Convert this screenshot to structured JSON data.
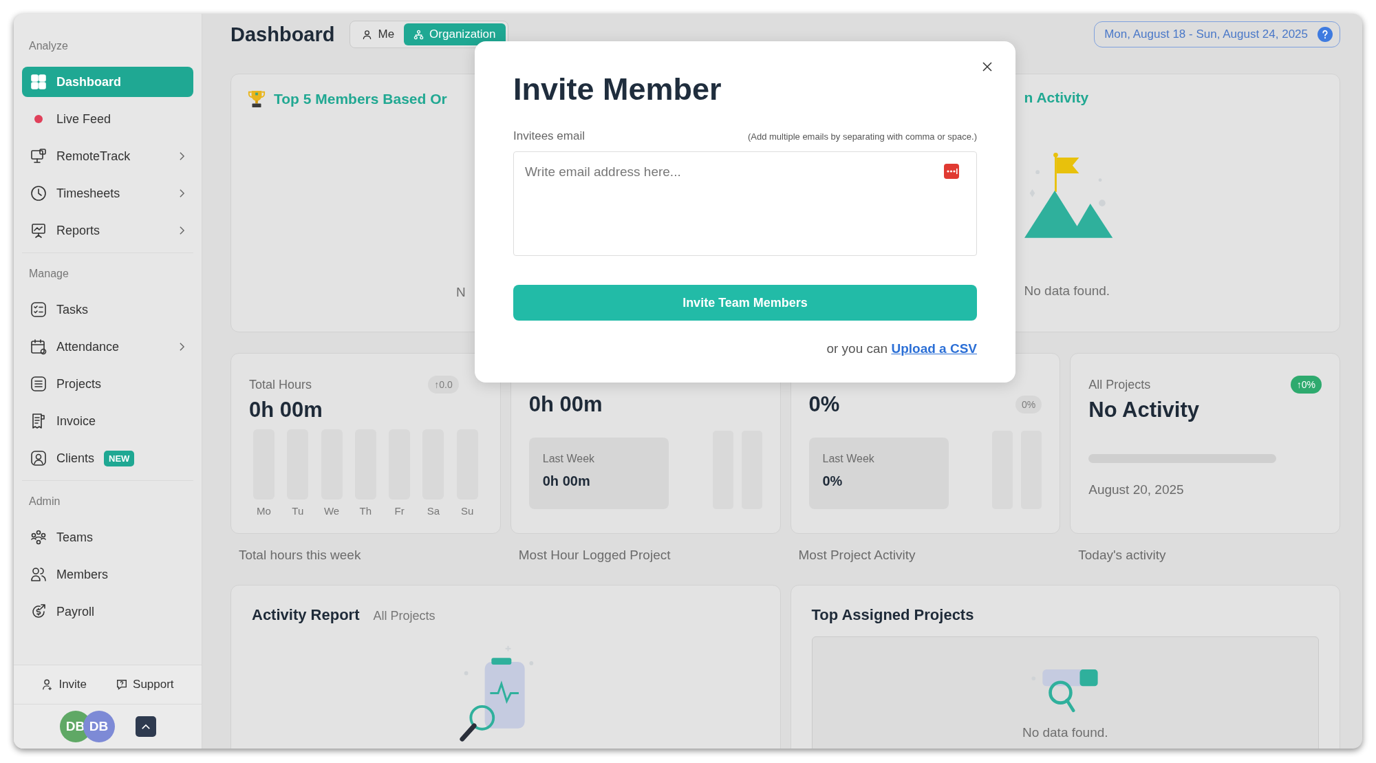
{
  "sidebar": {
    "sections": [
      {
        "title": "Analyze",
        "items": [
          {
            "label": "Dashboard",
            "selected": true,
            "submenu": false
          },
          {
            "label": "Live Feed",
            "selected": false,
            "submenu": false
          },
          {
            "label": "RemoteTrack",
            "selected": false,
            "submenu": true
          },
          {
            "label": "Timesheets",
            "selected": false,
            "submenu": true
          },
          {
            "label": "Reports",
            "selected": false,
            "submenu": true
          }
        ]
      },
      {
        "title": "Manage",
        "items": [
          {
            "label": "Tasks",
            "selected": false,
            "submenu": false
          },
          {
            "label": "Attendance",
            "selected": false,
            "submenu": true
          },
          {
            "label": "Projects",
            "selected": false,
            "submenu": false
          },
          {
            "label": "Invoice",
            "selected": false,
            "submenu": false
          },
          {
            "label": "Clients",
            "selected": false,
            "submenu": false,
            "badge": "NEW"
          }
        ]
      },
      {
        "title": "Admin",
        "items": [
          {
            "label": "Teams",
            "selected": false,
            "submenu": false
          },
          {
            "label": "Members",
            "selected": false,
            "submenu": false
          },
          {
            "label": "Payroll",
            "selected": false,
            "submenu": false
          }
        ]
      }
    ],
    "footer_links": [
      "Invite",
      "Support"
    ],
    "avatars": [
      {
        "initials": "DB",
        "color": "#5fa865"
      },
      {
        "initials": "DB",
        "color": "#7d8ad6"
      }
    ]
  },
  "header": {
    "title": "Dashboard",
    "scope_tabs": [
      {
        "label": "Me",
        "selected": false
      },
      {
        "label": "Organization",
        "selected": true
      }
    ],
    "date_range": "Mon, August 18 - Sun, August 24, 2025"
  },
  "top_cards": [
    {
      "title": "Top 5 Members Based Or",
      "empty_text": "N"
    },
    {
      "title": "n Activity",
      "empty_text": "No data found."
    }
  ],
  "stat_cards": [
    {
      "kind": "weekly",
      "label": "Total Hours",
      "value": "0h 00m",
      "badge": "↑0.0",
      "badge_active": false,
      "days": [
        "Mo",
        "Tu",
        "We",
        "Th",
        "Fr",
        "Sa",
        "Su"
      ],
      "caption": "Total hours this week"
    },
    {
      "kind": "compare",
      "value": "0h 00m",
      "last_label": "Last Week",
      "last_value": "0h 00m",
      "caption": "Most Hour Logged Project"
    },
    {
      "kind": "compare",
      "value": "0%",
      "badge": "0%",
      "badge_active": false,
      "last_label": "Last Week",
      "last_value": "0%",
      "caption": "Most Project Activity"
    },
    {
      "kind": "activity",
      "label": "All Projects",
      "value": "No Activity",
      "badge": "↑0%",
      "badge_active": true,
      "level": 0,
      "date": "August 20, 2025",
      "caption": "Today's activity"
    }
  ],
  "bottom_cards": [
    {
      "kind": "activity",
      "title": "Activity Report",
      "subtitle": "All Projects"
    },
    {
      "kind": "projects",
      "title": "Top Assigned Projects",
      "empty_text": "No data found."
    }
  ],
  "modal": {
    "title": "Invite Member",
    "field_label": "Invitees email",
    "field_hint": "(Add multiple emails by separating with comma or space.)",
    "placeholder": "Write email address here...",
    "button": "Invite Team Members",
    "upload_prefix": "or you can",
    "upload_link": "Upload a CSV"
  }
}
